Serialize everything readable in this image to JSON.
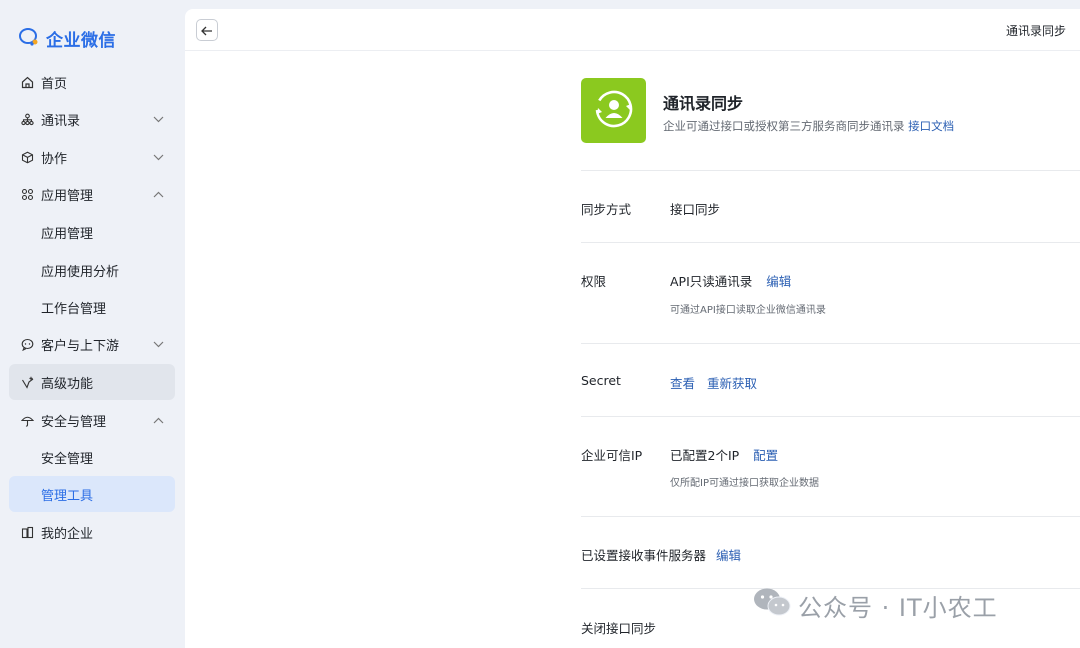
{
  "sidebar": {
    "logo_text": "企业微信",
    "items": [
      {
        "label": "首页",
        "icon": "home-icon"
      },
      {
        "label": "通讯录",
        "icon": "org-chart-icon"
      },
      {
        "label": "协作",
        "icon": "cube-icon"
      },
      {
        "label": "应用管理",
        "icon": "apps-grid-icon"
      },
      {
        "label": "应用管理"
      },
      {
        "label": "应用使用分析"
      },
      {
        "label": "工作台管理"
      },
      {
        "label": "客户与上下游",
        "icon": "chat-bubble-icon"
      },
      {
        "label": "高级功能",
        "icon": "sparkle-icon"
      },
      {
        "label": "安全与管理",
        "icon": "umbrella-icon"
      },
      {
        "label": "安全管理"
      },
      {
        "label": "管理工具"
      },
      {
        "label": "我的企业",
        "icon": "building-icon"
      }
    ]
  },
  "header": {
    "title": "通讯录同步"
  },
  "app": {
    "title": "通讯录同步",
    "description": "企业可通过接口或授权第三方服务商同步通讯录",
    "doc_link": "接口文档"
  },
  "rows": {
    "sync_method": {
      "label": "同步方式",
      "value": "接口同步"
    },
    "permission": {
      "label": "权限",
      "value": "API只读通讯录",
      "edit": "编辑",
      "hint": "可通过API接口读取企业微信通讯录"
    },
    "secret": {
      "label": "Secret",
      "view": "查看",
      "refresh": "重新获取"
    },
    "trusted_ip": {
      "label": "企业可信IP",
      "value": "已配置2个IP",
      "configure": "配置",
      "hint": "仅所配IP可通过接口获取企业数据"
    },
    "event_server": {
      "label": "已设置接收事件服务器",
      "edit": "编辑"
    },
    "close_sync": "关闭接口同步"
  },
  "watermark": "公众号 · IT小农工",
  "colors": {
    "accent": "#2b6ee6",
    "link": "#2b5fb3",
    "app_icon_bg": "#8bc91f"
  }
}
